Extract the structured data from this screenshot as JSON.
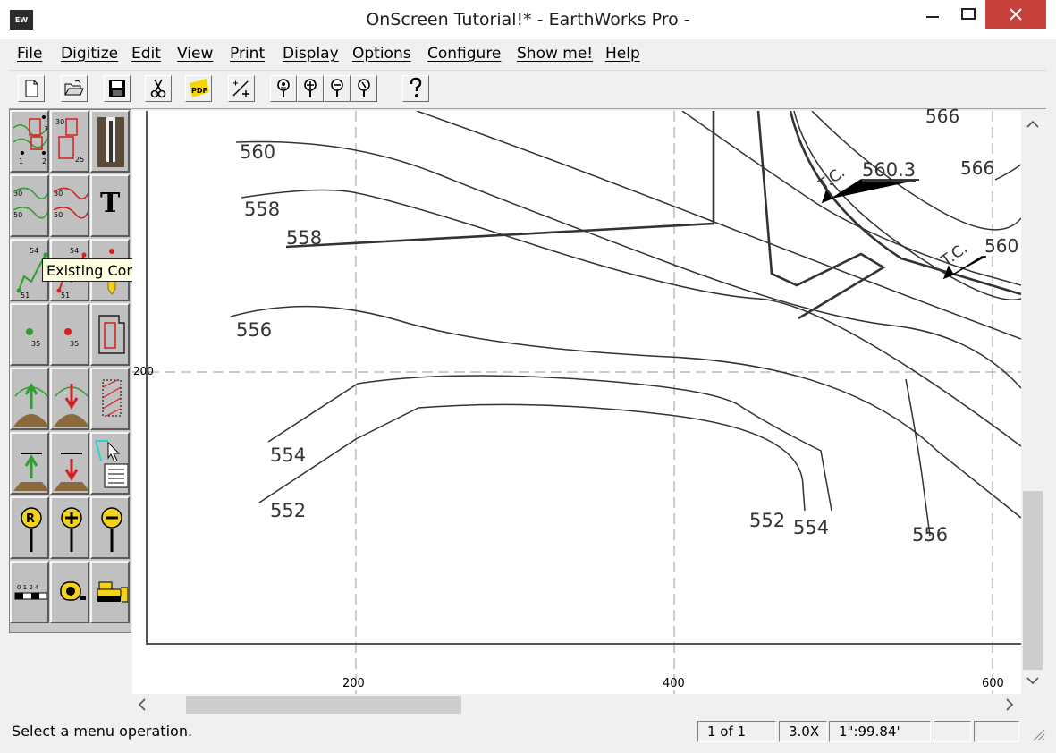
{
  "window": {
    "title": "OnScreen Tutorial!* - EarthWorks Pro -",
    "app_icon_text": "EW"
  },
  "menu": [
    "File",
    "Digitize",
    "Edit",
    "View",
    "Print",
    "Display",
    "Options",
    "Configure",
    "Show me!",
    "Help"
  ],
  "toolbar": {
    "buttons": [
      "new-file-icon",
      "open-folder-icon",
      "save-disk-icon",
      "cut-scissors-icon",
      "pdf-icon",
      "scale-draw-icon",
      "person-pin-1-icon",
      "person-pin-2-icon",
      "person-pin-3-icon",
      "person-pin-4-icon",
      "help-question-icon"
    ],
    "pdf_label": "PDF"
  },
  "palette": {
    "tooltip": "Existing Contour",
    "labels": {
      "t_letter": "T",
      "sample_30": "30",
      "sample_50": "50",
      "sample_54": "54",
      "sample_51": "51",
      "sample_35": "35",
      "sample_25": "25",
      "sample_3": "3",
      "sample_1": "1",
      "sample_2": "2",
      "ruler_ticks": "0 1 2 4"
    }
  },
  "canvas": {
    "contour_labels": [
      "566",
      "560",
      "560.3",
      "566",
      "558",
      "558",
      "560",
      "556",
      "554",
      "552",
      "552",
      "554",
      "556"
    ],
    "grid_label_y": "200",
    "axis_x_labels": [
      "200",
      "400",
      "600"
    ],
    "tc_label": "T.C."
  },
  "status": {
    "message": "Select a menu operation.",
    "page": "1 of 1",
    "zoom": "3.0X",
    "scale": "1\":99.84'"
  },
  "colors": {
    "close_button": "#c7413b",
    "tooltip_bg": "#ffffe1",
    "contour_line": "#333333",
    "palette_green": "#2f9e2f",
    "palette_red": "#d42020",
    "palette_yellow": "#f2d21b"
  }
}
